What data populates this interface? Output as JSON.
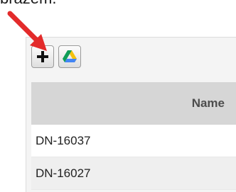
{
  "caption": {
    "text": "brazem."
  },
  "toolbar": {
    "buttons": [
      {
        "icon": "plus-icon"
      },
      {
        "icon": "google-drive-icon"
      }
    ]
  },
  "annotation": {
    "color": "#e32b2b"
  },
  "table": {
    "columns": [
      "Name"
    ],
    "rows": [
      "DN-16037",
      "DN-16027"
    ]
  }
}
